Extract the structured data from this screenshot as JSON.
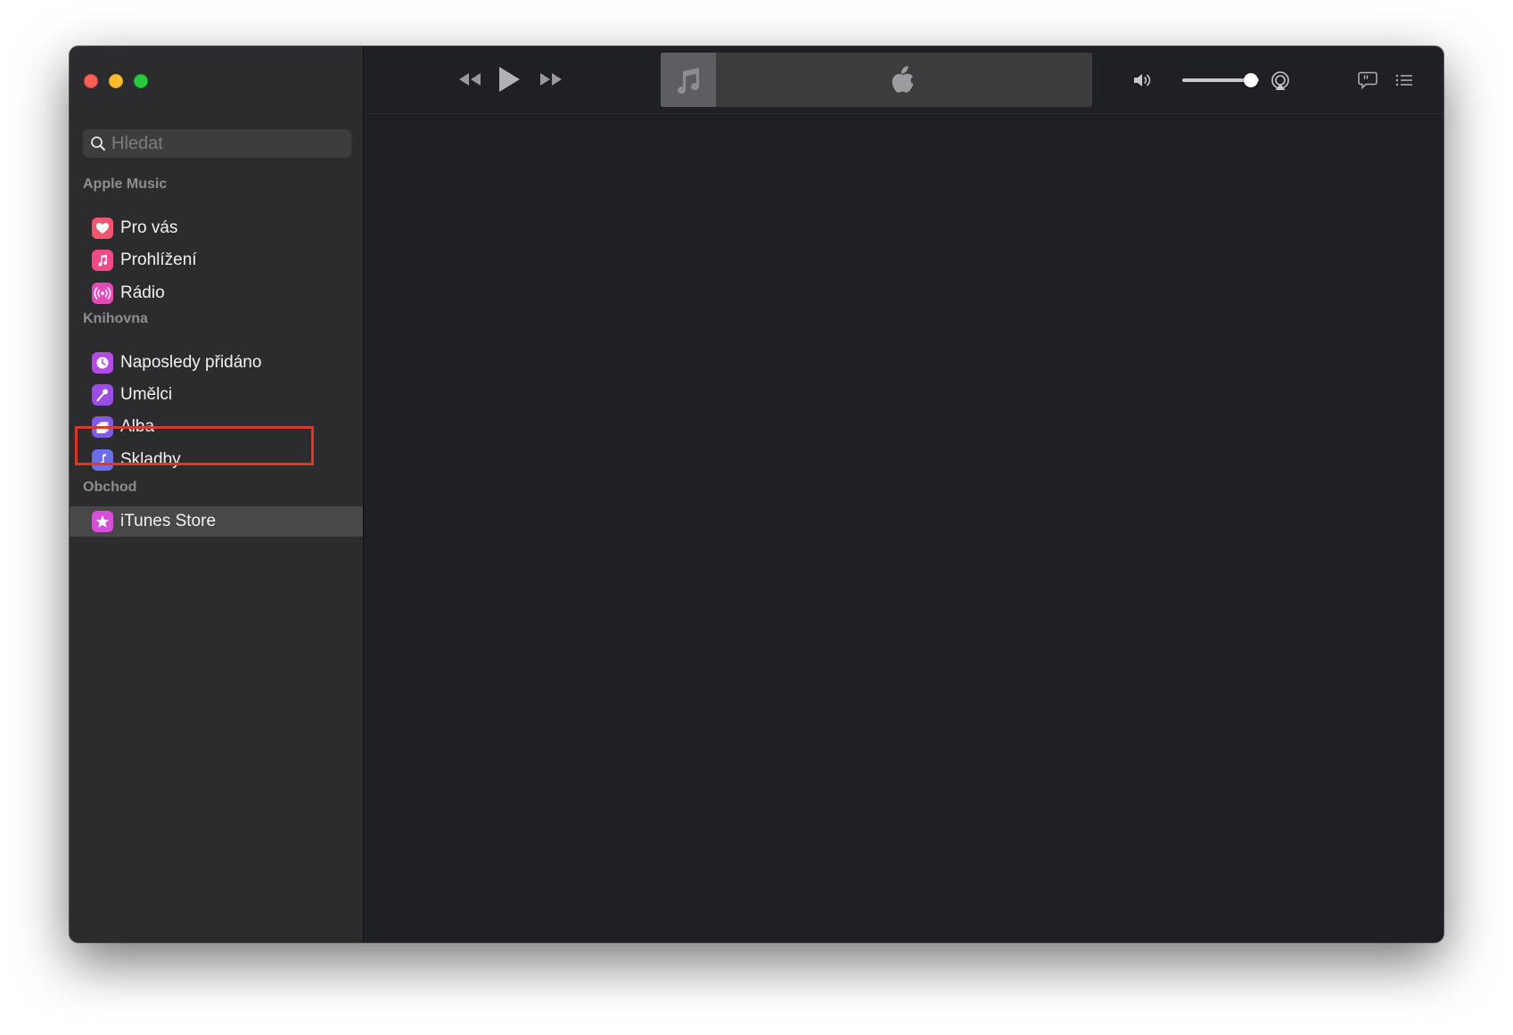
{
  "search": {
    "placeholder": "Hledat"
  },
  "sidebar": {
    "sections": [
      {
        "title": "Apple Music",
        "items": [
          {
            "label": "Pro vás",
            "icon": "heart-icon",
            "color": "#f0566e"
          },
          {
            "label": "Prohlížení",
            "icon": "music-note-icon",
            "color": "#ee4a86"
          },
          {
            "label": "Rádio",
            "icon": "radio-waves-icon",
            "color": "#e449b8"
          }
        ]
      },
      {
        "title": "Knihovna",
        "items": [
          {
            "label": "Naposledy přidáno",
            "icon": "clock-icon",
            "color": "#b54be6"
          },
          {
            "label": "Umělci",
            "icon": "microphone-icon",
            "color": "#9a4ce6"
          },
          {
            "label": "Alba",
            "icon": "album-stack-icon",
            "color": "#7f5ae6"
          },
          {
            "label": "Skladby",
            "icon": "music-note-icon",
            "color": "#6a6ee8",
            "highlighted": true
          }
        ]
      },
      {
        "title": "Obchod",
        "items": [
          {
            "label": "iTunes Store",
            "icon": "star-icon",
            "color": "#d74fd8",
            "selected": true
          }
        ]
      }
    ]
  },
  "player": {
    "volume_level": 0.9
  },
  "colors": {
    "sidebar_bg": "#2c2c2e",
    "main_bg": "#1f2024",
    "highlight_box": "#d93a2b",
    "close": "#fe5f57",
    "minimize": "#febc2e",
    "zoom": "#28c840"
  }
}
